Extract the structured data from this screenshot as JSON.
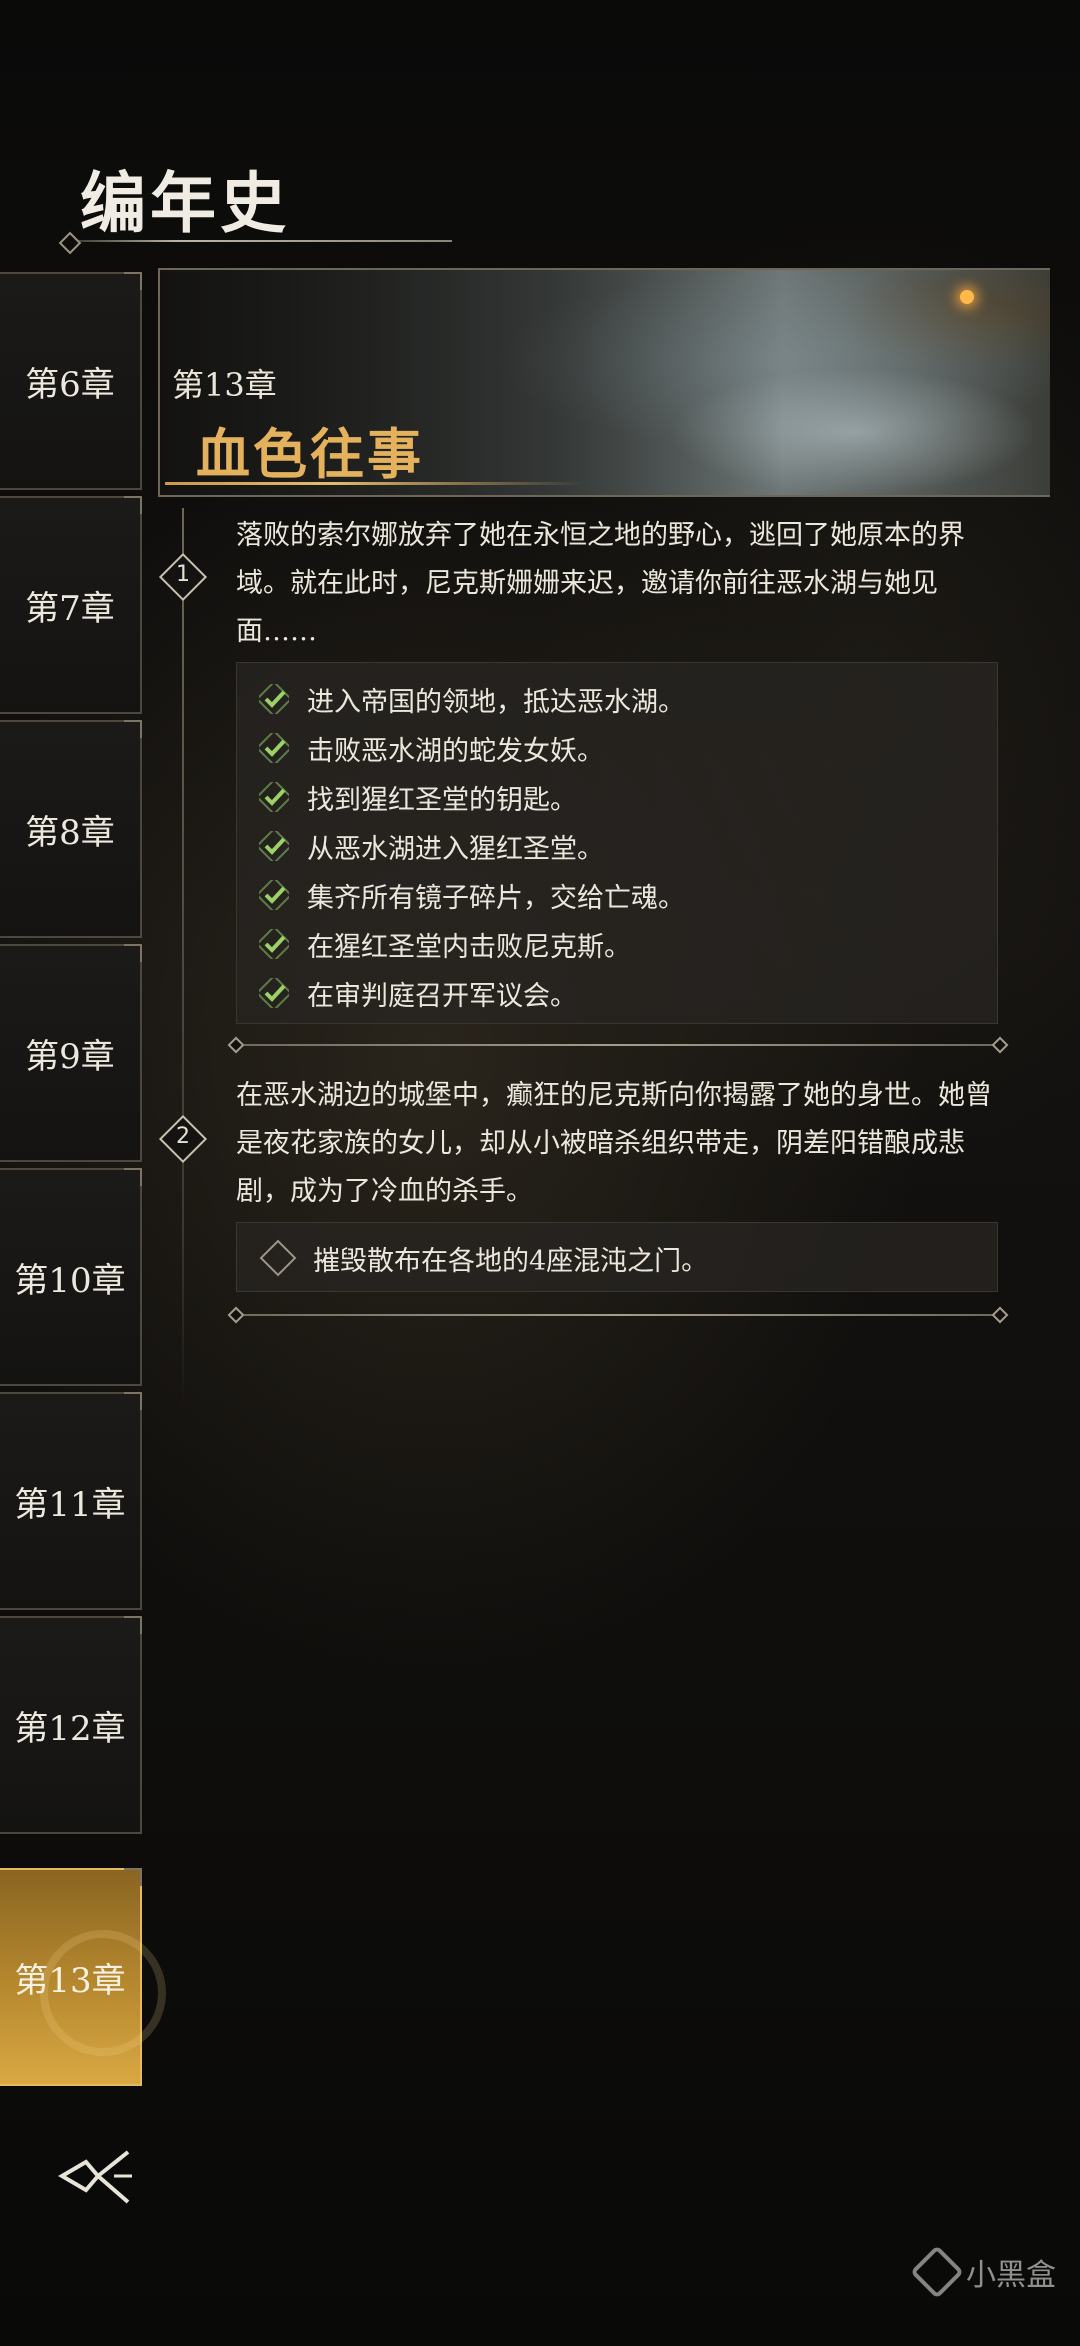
{
  "header": {
    "title": "编年史"
  },
  "sidebar": {
    "tabs": [
      {
        "label": "第6章"
      },
      {
        "label": "第7章"
      },
      {
        "label": "第8章"
      },
      {
        "label": "第9章"
      },
      {
        "label": "第10章"
      },
      {
        "label": "第11章"
      },
      {
        "label": "第12章"
      },
      {
        "label": "第13章",
        "active": true
      }
    ]
  },
  "chapter": {
    "number": "第13章",
    "title": "血色往事"
  },
  "steps": [
    {
      "marker": "1",
      "description": "落败的索尔娜放弃了她在永恒之地的野心，逃回了她原本的界域。就在此时，尼克斯姗姗来迟，邀请你前往恶水湖与她见面……",
      "tasks": [
        {
          "text": "进入帝国的领地，抵达恶水湖。",
          "done": true
        },
        {
          "text": "击败恶水湖的蛇发女妖。",
          "done": true
        },
        {
          "text": "找到猩红圣堂的钥匙。",
          "done": true
        },
        {
          "text": "从恶水湖进入猩红圣堂。",
          "done": true
        },
        {
          "text": "集齐所有镜子碎片，交给亡魂。",
          "done": true
        },
        {
          "text": "在猩红圣堂内击败尼克斯。",
          "done": true
        },
        {
          "text": "在审判庭召开军议会。",
          "done": true
        }
      ]
    },
    {
      "marker": "2",
      "description": "在恶水湖边的城堡中，癫狂的尼克斯向你揭露了她的身世。她曾是夜花家族的女儿，却从小被暗杀组织带走，阴差阳错酿成悲剧，成为了冷血的杀手。",
      "tasks": [
        {
          "text": "摧毁散布在各地的4座混沌之门。",
          "done": false
        }
      ]
    }
  ],
  "watermark": {
    "text": "小黑盒"
  },
  "colors": {
    "accent_gold": "#e4b25d",
    "check_green": "#8fcf5c",
    "active_tab": "#b7892f"
  },
  "icons": {
    "back": "back-arrow-icon",
    "check": "check-icon",
    "pending": "diamond-outline-icon"
  }
}
